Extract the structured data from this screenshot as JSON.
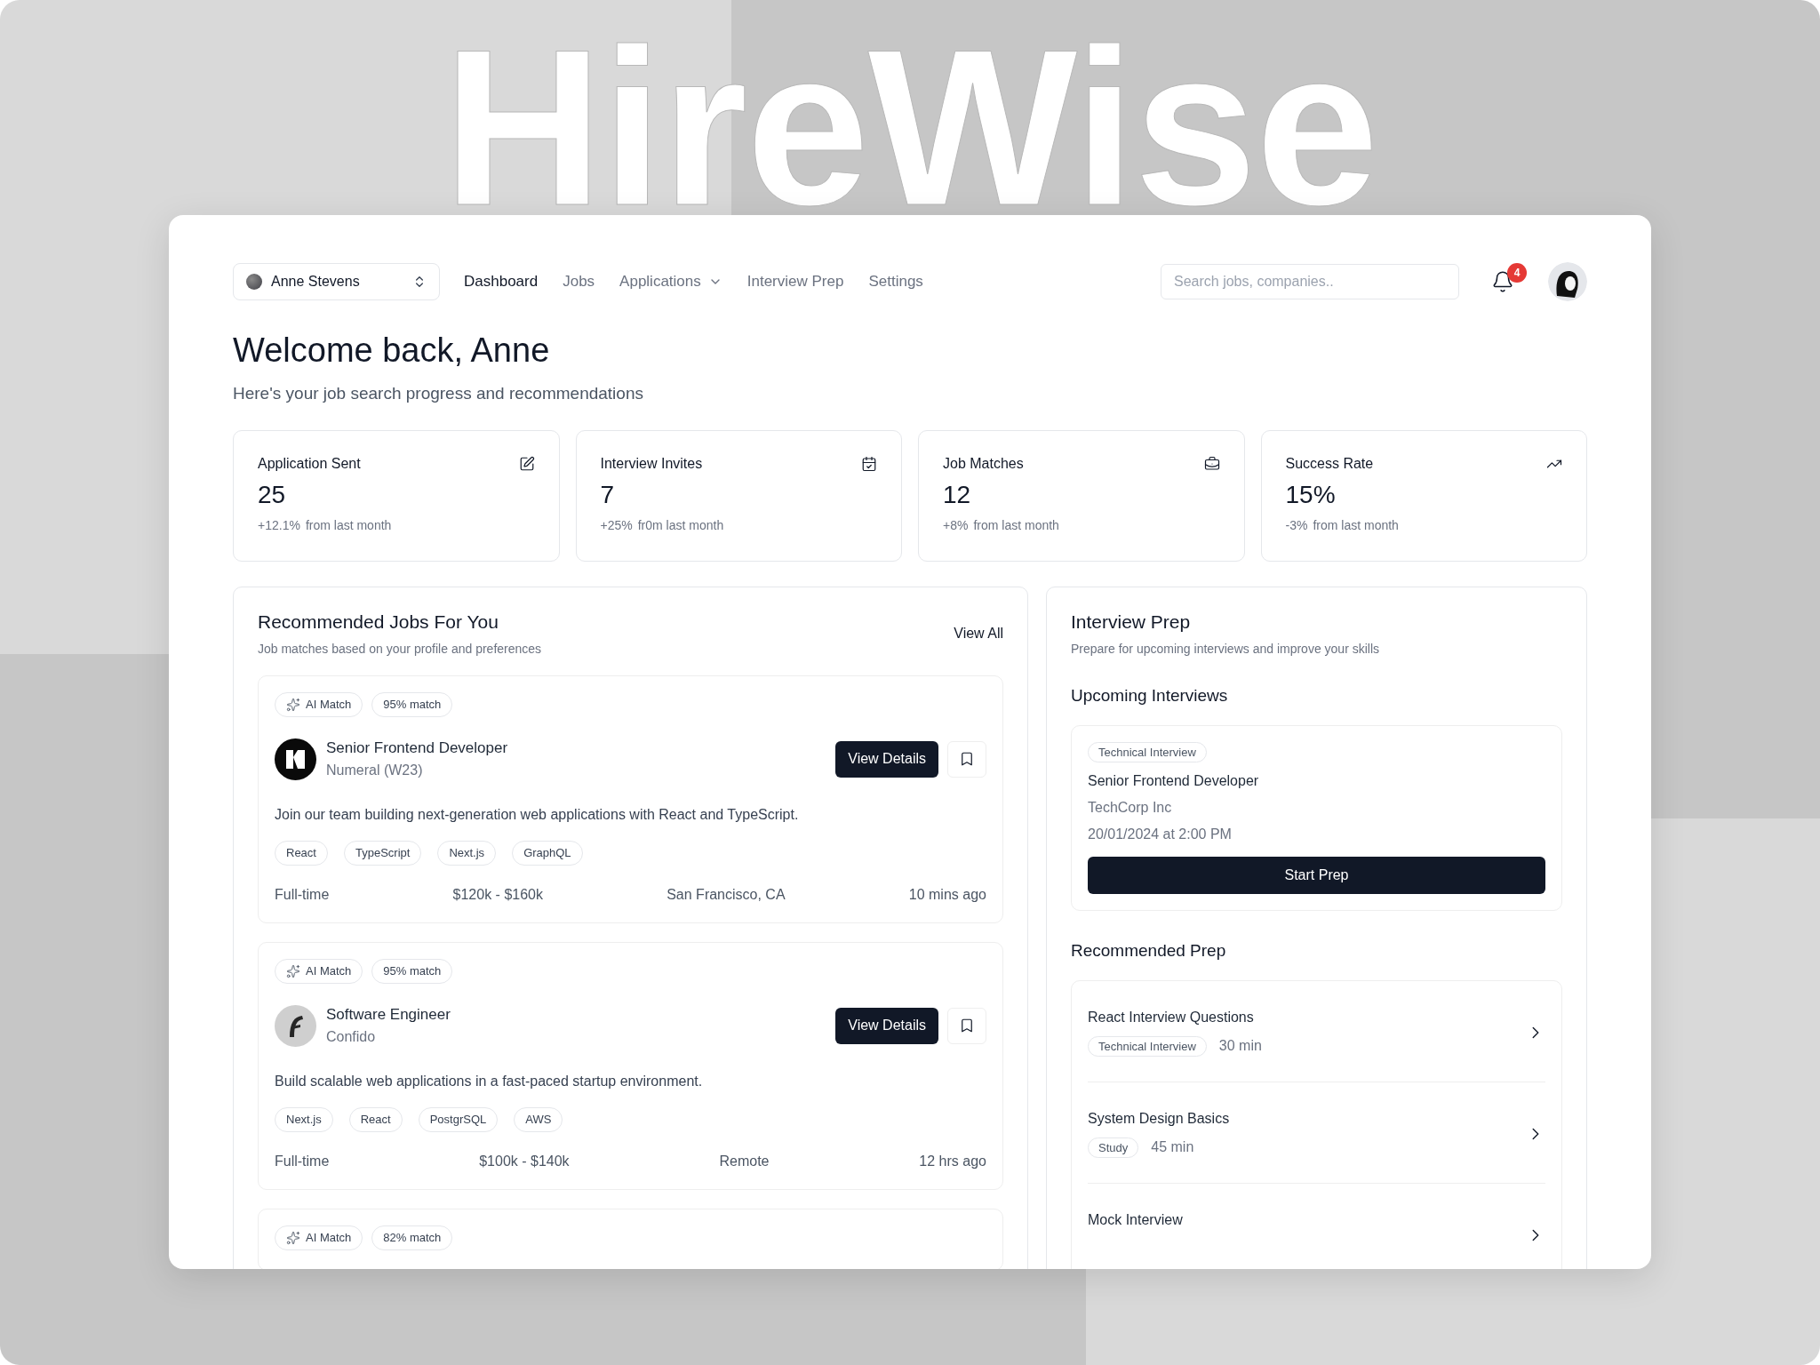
{
  "brand": {
    "title": "HireWise"
  },
  "nav": {
    "account": {
      "name": "Anne Stevens"
    },
    "items": [
      {
        "label": "Dashboard",
        "selected": true,
        "has_menu": false
      },
      {
        "label": "Jobs",
        "selected": false,
        "has_menu": false
      },
      {
        "label": "Applications",
        "selected": false,
        "has_menu": true
      },
      {
        "label": "Interview Prep",
        "selected": false,
        "has_menu": false
      },
      {
        "label": "Settings",
        "selected": false,
        "has_menu": false
      }
    ],
    "search": {
      "placeholder": "Search jobs, companies.."
    },
    "notifications": {
      "count": "4"
    }
  },
  "welcome": {
    "title": "Welcome back, Anne",
    "subtitle": "Here's your job search progress and recommendations"
  },
  "stats": [
    {
      "kind": "edit",
      "title": "Application Sent",
      "value": "25",
      "change": "+12.1%",
      "note": "from last month"
    },
    {
      "kind": "calendar",
      "title": "Interview Invites",
      "value": "7",
      "change": "+25%",
      "note": "fr0m last month"
    },
    {
      "kind": "briefcase",
      "title": "Job Matches",
      "value": "12",
      "change": "+8%",
      "note": "from last month"
    },
    {
      "kind": "trend",
      "title": "Success Rate",
      "value": "15%",
      "change": "-3%",
      "note": "from last month"
    }
  ],
  "jobs": {
    "title": "Recommended Jobs For You",
    "subtitle": "Job matches based on your profile and preferences",
    "view_all": "View All",
    "items": [
      {
        "ai_badge": "AI Match",
        "match": "95% match",
        "kind": "block",
        "title": "Senior Frontend Developer",
        "company": "Numeral (W23)",
        "button": "View Details",
        "description": "Join our team building next-generation web applications with React and TypeScript.",
        "tags": [
          "React",
          "TypeScript",
          "Next.js",
          "GraphQL"
        ],
        "type": "Full-time",
        "salary": "$120k - $160k",
        "location": "San Francisco, CA",
        "posted": "10 mins ago"
      },
      {
        "ai_badge": "AI Match",
        "match": "95% match",
        "kind": "stroke",
        "title": "Software Engineer",
        "company": "Confido",
        "button": "View Details",
        "description": "Build scalable web applications in a fast-paced startup environment.",
        "tags": [
          "Next.js",
          "React",
          "PostgrSQL",
          "AWS"
        ],
        "type": "Full-time",
        "salary": "$100k - $140k",
        "location": "Remote",
        "posted": "12 hrs ago"
      },
      {
        "ai_badge": "AI Match",
        "match": "82% match"
      }
    ]
  },
  "prep": {
    "title": "Interview Prep",
    "subtitle": "Prepare for upcoming interviews and improve your skills",
    "upcoming_title": "Upcoming Interviews",
    "upcoming": {
      "tag": "Technical Interview",
      "title": "Senior Frontend Developer",
      "company": "TechCorp Inc",
      "date": "20/01/2024 at 2:00 PM",
      "button": "Start Prep"
    },
    "recommended_title": "Recommended Prep",
    "recommended": [
      {
        "title": "React Interview Questions",
        "tag": "Technical Interview",
        "duration": "30 min"
      },
      {
        "title": "System Design Basics",
        "tag": "Study",
        "duration": "45 min"
      },
      {
        "title": "Mock Interview"
      }
    ]
  }
}
